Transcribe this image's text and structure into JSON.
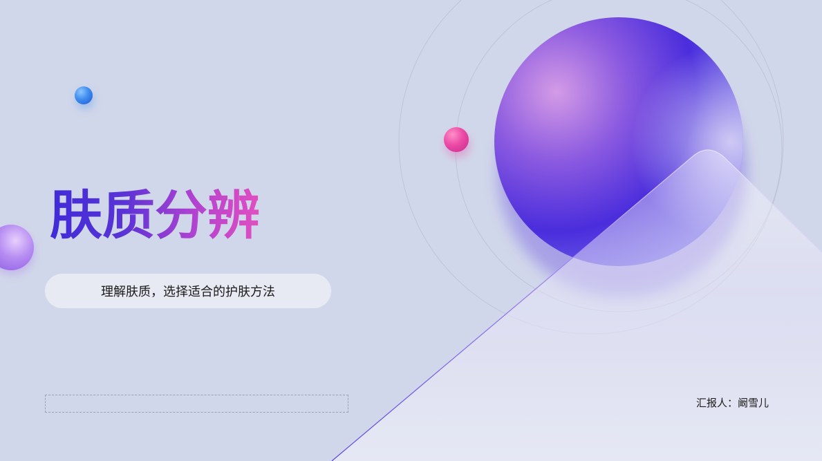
{
  "slide": {
    "title": "肤质分辨",
    "subtitle": "理解肤质，选择适合的护肤方法",
    "reporter": "汇报人：阚雪儿"
  },
  "colors": {
    "background": "#d1d7ea",
    "title_gradient_start": "#3f2bd8",
    "title_gradient_end": "#e14fc0",
    "big_sphere": "#4a2ddc",
    "pink_ball": "#e94aa8",
    "blue_ball": "#3f8ef0",
    "purple_ball": "#b48cf0"
  },
  "icons": [
    "blue-sphere-icon",
    "pink-sphere-icon",
    "purple-sphere-icon",
    "big-gradient-sphere-icon",
    "glass-triangle-icon"
  ]
}
